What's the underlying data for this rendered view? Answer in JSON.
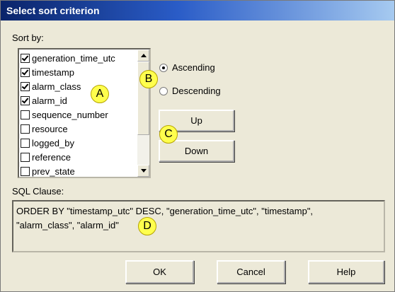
{
  "window": {
    "title": "Select sort criterion"
  },
  "sort_by": {
    "label": "Sort by:",
    "items": [
      {
        "label": "generation_time_utc",
        "checked": true
      },
      {
        "label": "timestamp",
        "checked": true
      },
      {
        "label": "alarm_class",
        "checked": true
      },
      {
        "label": "alarm_id",
        "checked": true
      },
      {
        "label": "sequence_number",
        "checked": false
      },
      {
        "label": "resource",
        "checked": false
      },
      {
        "label": "logged_by",
        "checked": false
      },
      {
        "label": "reference",
        "checked": false
      },
      {
        "label": "prev_state",
        "checked": false
      }
    ]
  },
  "order": {
    "ascending_label": "Ascending",
    "descending_label": "Descending",
    "selected": "Ascending"
  },
  "move": {
    "up_label": "Up",
    "down_label": "Down"
  },
  "sql": {
    "label": "SQL Clause:",
    "text": "ORDER BY \"timestamp_utc\" DESC, \"generation_time_utc\", \"timestamp\",\n\"alarm_class\", \"alarm_id\""
  },
  "footer": {
    "ok_label": "OK",
    "cancel_label": "Cancel",
    "help_label": "Help"
  },
  "markers": {
    "a": "A",
    "b": "B",
    "c": "C",
    "d": "D"
  }
}
